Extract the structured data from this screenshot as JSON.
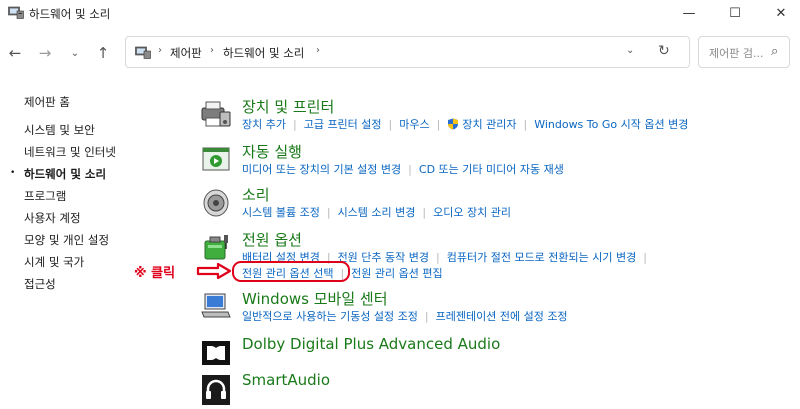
{
  "window": {
    "title": "하드웨어 및 소리",
    "min_glyph": "—",
    "max_glyph": "☐",
    "close_glyph": "✕"
  },
  "nav": {
    "back": "←",
    "forward": "→",
    "recent": "⌄",
    "up": "↑"
  },
  "address": {
    "sep1": "›",
    "crumb1": "제어판",
    "sep2": "›",
    "crumb2": "하드웨어 및 소리",
    "sep3": "›",
    "dropdown": "⌄",
    "refresh": "↻"
  },
  "search": {
    "placeholder": "제어판 검...",
    "icon": "⌕"
  },
  "sidebar": {
    "items": [
      {
        "label": "제어판 홈"
      },
      {
        "label": "시스템 및 보안"
      },
      {
        "label": "네트워크 및 인터넷"
      },
      {
        "label": "하드웨어 및 소리",
        "current": true
      },
      {
        "label": "프로그램"
      },
      {
        "label": "사용자 계정"
      },
      {
        "label": "모양 및 개인 설정"
      },
      {
        "label": "시계 및 국가"
      },
      {
        "label": "접근성"
      }
    ],
    "bullet": "•"
  },
  "categories": [
    {
      "title": "장치 및 프린터",
      "links": [
        "장치 추가",
        "고급 프린터 설정",
        "마우스",
        "장치 관리자",
        "Windows To Go 시작 옵션 변경"
      ]
    },
    {
      "title": "자동 실행",
      "links": [
        "미디어 또는 장치의 기본 설정 변경",
        "CD 또는 기타 미디어 자동 재생"
      ]
    },
    {
      "title": "소리",
      "links": [
        "시스템 볼륨 조정",
        "시스템 소리 변경",
        "오디오 장치 관리"
      ]
    },
    {
      "title": "전원 옵션",
      "links": [
        "배터리 설정 변경",
        "전원 단추 동작 변경",
        "컴퓨터가 절전 모드로 전환되는 시기 변경"
      ],
      "links2": [
        "전원 관리 옵션 선택",
        "전원 관리 옵션 편집"
      ]
    },
    {
      "title": "Windows 모바일 센터",
      "links": [
        "일반적으로 사용하는 기동성 설정 조정",
        "프레젠테이션 전에 설정 조정"
      ]
    },
    {
      "title": "Dolby Digital Plus Advanced Audio"
    },
    {
      "title": "SmartAudio"
    }
  ],
  "annotation": {
    "text": "※ 클릭"
  },
  "colors": {
    "link": "#0a66c2",
    "category_title": "#1a7a1a",
    "annotation": "#e0001a"
  }
}
